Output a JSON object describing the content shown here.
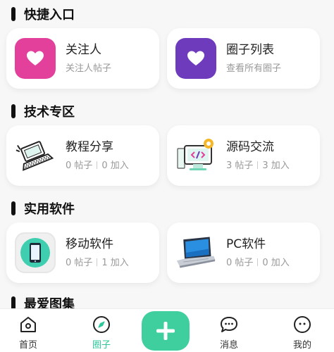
{
  "sections": [
    {
      "title": "快捷入口",
      "cards": [
        {
          "name": "关注人",
          "sub_text": "关注人帖子",
          "icon": "heart-icon",
          "icon_bg": "#e2409b"
        },
        {
          "name": "圈子列表",
          "sub_text": "查看所有圈子",
          "icon": "heart-icon",
          "icon_bg": "#6f3bbd"
        }
      ]
    },
    {
      "title": "技术专区",
      "cards": [
        {
          "name": "教程分享",
          "posts": "0 帖子",
          "joined": "0 加入",
          "icon": "laptop-illustration-icon"
        },
        {
          "name": "源码交流",
          "posts": "3 帖子",
          "joined": "3 加入",
          "icon": "code-monitor-icon"
        }
      ]
    },
    {
      "title": "实用软件",
      "cards": [
        {
          "name": "移动软件",
          "posts": "0 帖子",
          "joined": "1 加入",
          "icon": "mobile-phone-icon"
        },
        {
          "name": "PC软件",
          "posts": "0 帖子",
          "joined": "0 加入",
          "icon": "pc-laptop-icon"
        }
      ]
    },
    {
      "title": "最爱图集"
    }
  ],
  "tabbar": {
    "items": [
      {
        "label": "首页",
        "icon": "home-icon"
      },
      {
        "label": "圈子",
        "icon": "compass-icon",
        "active": true
      },
      {
        "label": "",
        "icon": "plus-icon"
      },
      {
        "label": "消息",
        "icon": "chat-bubble-icon"
      },
      {
        "label": "我的",
        "icon": "face-icon"
      }
    ]
  },
  "colors": {
    "accent": "#3fcf9f",
    "active_tab": "#2fc79a",
    "pink": "#e2409b",
    "purple": "#6f3bbd"
  }
}
